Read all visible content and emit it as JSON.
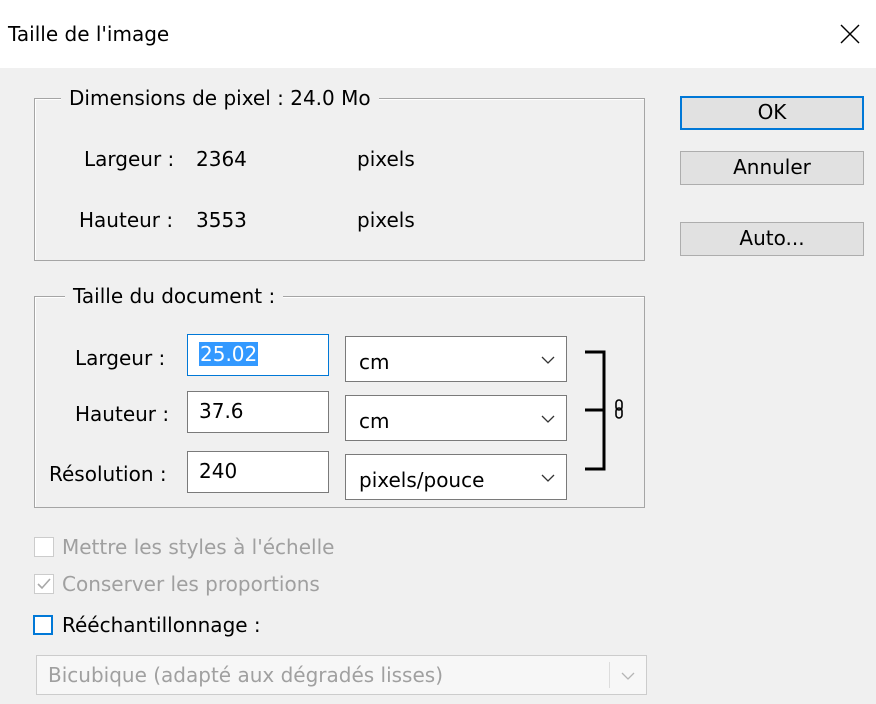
{
  "window": {
    "title": "Taille de l'image",
    "close_icon": "close-icon"
  },
  "pixel_dimensions": {
    "legend": "Dimensions de pixel :  24.0 Mo",
    "width_label": "Largeur :",
    "width_value": "2364",
    "width_unit": "pixels",
    "height_label": "Hauteur :",
    "height_value": "3553",
    "height_unit": "pixels"
  },
  "document_size": {
    "legend": "Taille du document :",
    "width_label": "Largeur :",
    "width_value": "25.02",
    "width_unit": "cm",
    "height_label": "Hauteur :",
    "height_value": "37.6",
    "height_unit": "cm",
    "resolution_label": "Résolution :",
    "resolution_value": "240",
    "resolution_unit": "pixels/pouce",
    "link_icon": "chain-link-icon"
  },
  "buttons": {
    "ok": "OK",
    "cancel": "Annuler",
    "auto": "Auto..."
  },
  "options": {
    "scale_styles": {
      "label": "Mettre les styles à l'échelle",
      "checked": false,
      "enabled": false
    },
    "constrain_proportions": {
      "label": "Conserver les proportions",
      "checked": true,
      "enabled": false
    },
    "resample": {
      "label": "Rééchantillonnage :",
      "checked": false,
      "enabled": true
    },
    "resample_method": "Bicubique (adapté aux dégradés lisses)"
  },
  "colors": {
    "accent": "#0078d7",
    "selection": "#3399ff",
    "disabled_text": "#a0a0a0"
  }
}
